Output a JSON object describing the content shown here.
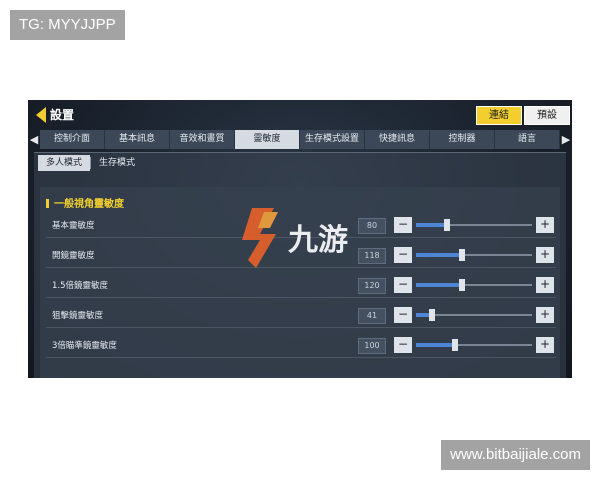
{
  "watermarks": {
    "top_left": "TG: MYYJJPP",
    "bottom_right": "www.bitbaijiale.com"
  },
  "header": {
    "title": "設置",
    "connect_label": "連結",
    "preset_label": "預設"
  },
  "tabs": [
    {
      "label": "控制介面",
      "active": false
    },
    {
      "label": "基本訊息",
      "active": false
    },
    {
      "label": "音效和畫質",
      "active": false
    },
    {
      "label": "靈敏度",
      "active": true
    },
    {
      "label": "生存模式設置",
      "active": false
    },
    {
      "label": "快捷訊息",
      "active": false
    },
    {
      "label": "控制器",
      "active": false
    },
    {
      "label": "語言",
      "active": false
    }
  ],
  "tab_arrows": {
    "left": "◀",
    "right": "▶"
  },
  "subtabs": [
    {
      "label": "多人模式",
      "active": true
    },
    {
      "label": "生存模式",
      "active": false
    }
  ],
  "section": {
    "title": "一般視角靈敏度"
  },
  "slider_controls": {
    "minus": "−",
    "plus": "+"
  },
  "slider_max": 300,
  "sliders": [
    {
      "label": "基本靈敏度",
      "value": "80"
    },
    {
      "label": "開鏡靈敏度",
      "value": "118"
    },
    {
      "label": "1.5倍鏡靈敏度",
      "value": "120"
    },
    {
      "label": "狙擊鏡靈敏度",
      "value": "41"
    },
    {
      "label": "3倍瞄準鏡靈敏度",
      "value": "100"
    }
  ],
  "logo": {
    "text": "九游"
  },
  "colors": {
    "accent": "#f2cf2f",
    "slider_fill": "#4d86d6"
  }
}
